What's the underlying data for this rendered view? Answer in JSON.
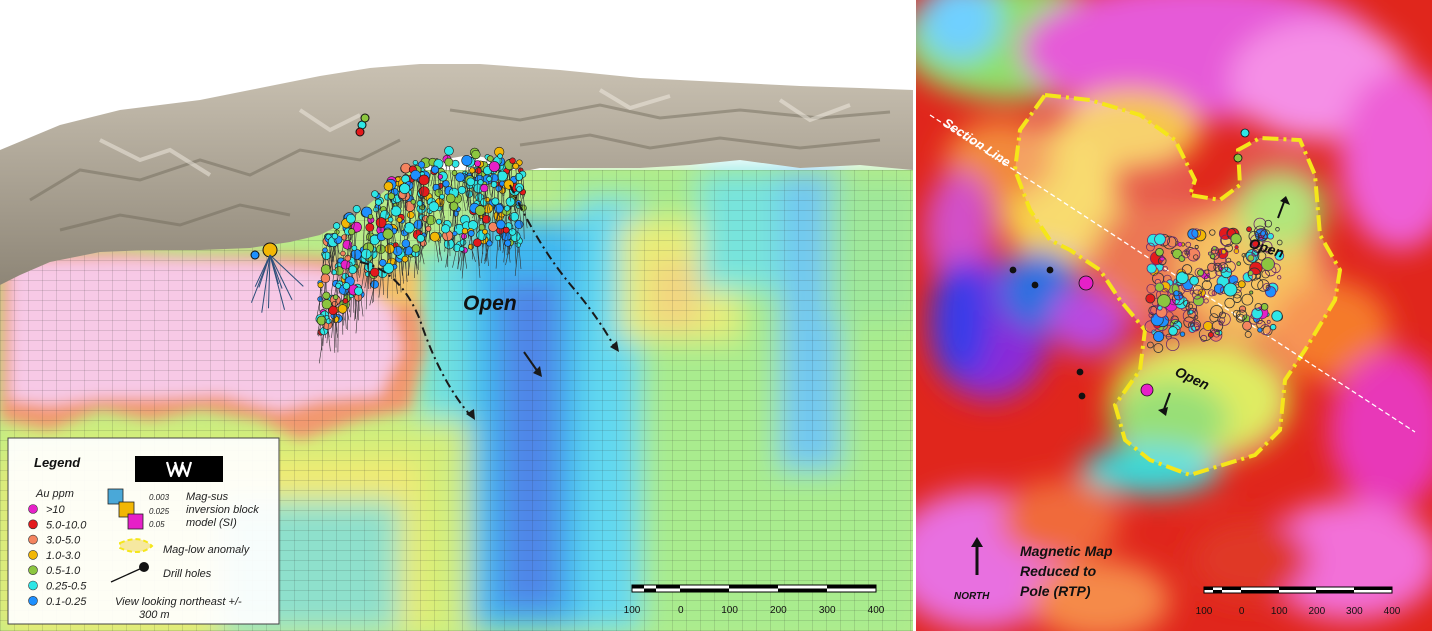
{
  "left_panel": {
    "open_label": "Open",
    "scale_ticks": [
      "100",
      "0",
      "100",
      "200",
      "300",
      "400"
    ]
  },
  "legend": {
    "title": "Legend",
    "au_title": "Au ppm",
    "au_classes": [
      {
        "label": ">10",
        "color": "#e620c8"
      },
      {
        "label": "5.0-10.0",
        "color": "#e31a1c"
      },
      {
        "label": "3.0-5.0",
        "color": "#f4845f"
      },
      {
        "label": "1.0-3.0",
        "color": "#f2b705"
      },
      {
        "label": "0.5-1.0",
        "color": "#8cc63f"
      },
      {
        "label": "0.25-0.5",
        "color": "#2ee6e6"
      },
      {
        "label": "0.1-0.25",
        "color": "#1e90ff"
      }
    ],
    "magsus_values": [
      "0.003",
      "0.025",
      "0.05"
    ],
    "magsus_colors": [
      "#4aa8d8",
      "#f2b705",
      "#e620c8"
    ],
    "magsus_label": [
      "Mag-sus",
      "inversion block",
      "model (SI)"
    ],
    "maglow_label": "Mag-low anomaly",
    "drill_label": "Drill holes",
    "view_note": [
      "View looking northeast +/-",
      "300 m"
    ]
  },
  "right_panel": {
    "section_line_label": "Section Line",
    "open_labels": [
      "Open",
      "Open"
    ],
    "north_label": "NORTH",
    "map_title": [
      "Magnetic Map",
      "Reduced to",
      "Pole (RTP)"
    ],
    "scale_ticks": [
      "100",
      "0",
      "100",
      "200",
      "300",
      "400"
    ]
  },
  "colors": {
    "anomaly_outline": "#f5e61a",
    "background": "#ffffff"
  }
}
